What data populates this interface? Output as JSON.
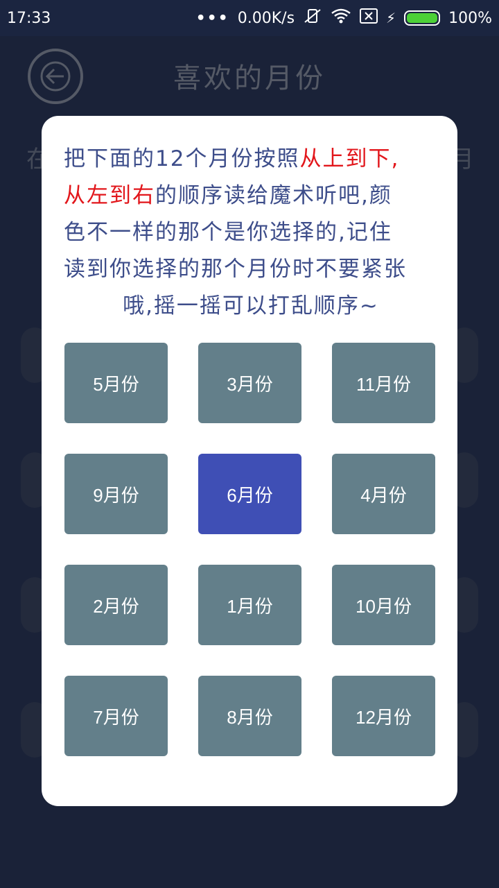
{
  "status_bar": {
    "time": "17:33",
    "network_speed": "0.00K/s",
    "battery_percent": "100%",
    "battery_level": 1.0,
    "icons": [
      "more-dots-icon",
      "mute-vibrate-icon",
      "wifi-icon",
      "sim-off-icon",
      "charging-bolt-icon",
      "battery-icon"
    ]
  },
  "header": {
    "title": "喜欢的月份",
    "back_icon": "back-arrow-icon"
  },
  "background_edges": {
    "left_char": "在",
    "right_char": "月"
  },
  "dialog": {
    "instruction": {
      "line1_part1": "把下面的12个月份按照",
      "line1_red": "从上到下,",
      "line2_red": "从左到右",
      "line2_part2": "的顺序读给魔术听吧,颜",
      "line3": "色不一样的那个是你选择的,记住",
      "line4": "读到你选择的那个月份时不要紧张",
      "line5": "哦,摇一摇可以打乱顺序~"
    },
    "months": [
      {
        "label": "5月份",
        "selected": false
      },
      {
        "label": "3月份",
        "selected": false
      },
      {
        "label": "11月份",
        "selected": false
      },
      {
        "label": "9月份",
        "selected": false
      },
      {
        "label": "6月份",
        "selected": true
      },
      {
        "label": "4月份",
        "selected": false
      },
      {
        "label": "2月份",
        "selected": false
      },
      {
        "label": "1月份",
        "selected": false
      },
      {
        "label": "10月份",
        "selected": false
      },
      {
        "label": "7月份",
        "selected": false
      },
      {
        "label": "8月份",
        "selected": false
      },
      {
        "label": "12月份",
        "selected": false
      }
    ]
  },
  "colors": {
    "background": "#1a2238",
    "dialog": "#ffffff",
    "text_blue": "#3d4d8a",
    "text_red": "#e2161b",
    "month_button": "#637f8a",
    "month_button_selected": "#3f4fb5"
  }
}
